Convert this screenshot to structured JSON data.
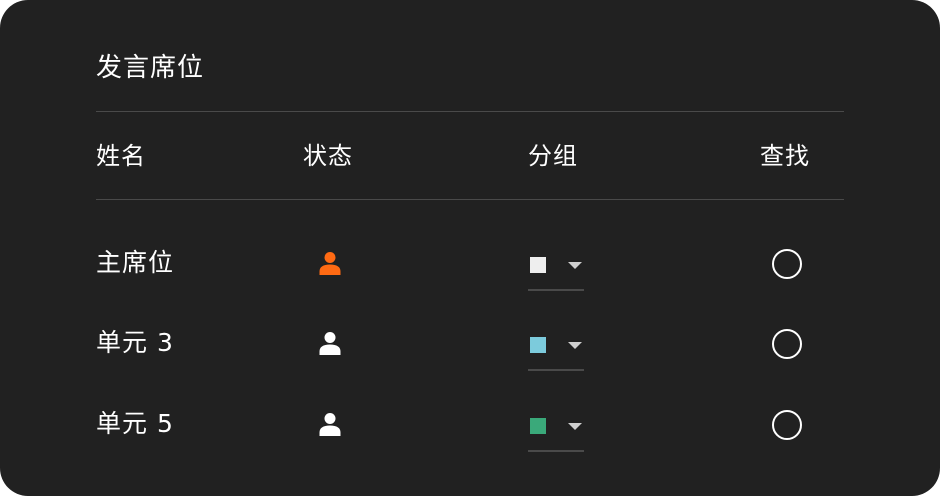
{
  "title": "发言席位",
  "headers": {
    "name": "姓名",
    "status": "状态",
    "group": "分组",
    "find": "查找"
  },
  "rows": [
    {
      "name": "主席位",
      "status_icon": "person-icon",
      "status_color": "#ff6a13",
      "group_color": "#eeeeee",
      "find_selected": false
    },
    {
      "name": "单元 3",
      "status_icon": "person-icon",
      "status_color": "#ffffff",
      "group_color": "#7ccbdc",
      "find_selected": false
    },
    {
      "name": "单元 5",
      "status_icon": "person-icon",
      "status_color": "#ffffff",
      "group_color": "#3aa97a",
      "find_selected": false
    }
  ],
  "colors": {
    "panel_background": "#212121",
    "divider": "#4a4a4a",
    "text": "#ffffff",
    "active_accent": "#ff6a13"
  }
}
